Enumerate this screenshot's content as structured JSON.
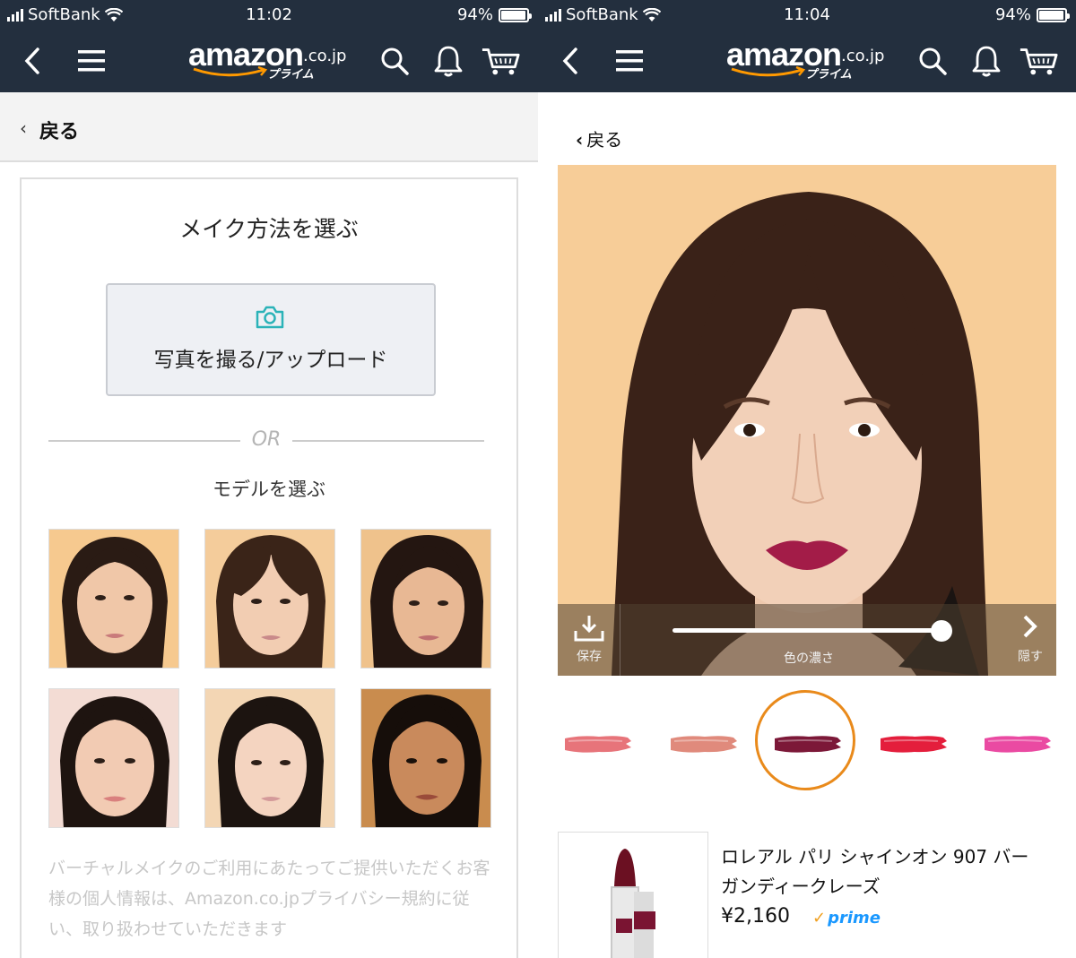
{
  "left": {
    "status": {
      "carrier": "SoftBank",
      "time": "11:02",
      "battery": "94%",
      "battery_level": 0.94
    },
    "logo": {
      "word": "amazon",
      "domain": ".co.jp",
      "sub": "プライム"
    },
    "back_label": "戻る",
    "heading": "メイク方法を選ぶ",
    "upload_label": "写真を撮る/アップロード",
    "or_text": "OR",
    "model_heading": "モデルを選ぶ",
    "disclaimer": "バーチャルメイクのご利用にあたってご提供いただくお客様の個人情報は、Amazon.co.jpプライバシー規約に従い、取り扱わせていただきます"
  },
  "right": {
    "status": {
      "carrier": "SoftBank",
      "time": "11:04",
      "battery": "94%",
      "battery_level": 0.94
    },
    "logo": {
      "word": "amazon",
      "domain": ".co.jp",
      "sub": "プライム"
    },
    "back_label": "戻る",
    "save_label": "保存",
    "slider_label": "色の濃さ",
    "slider_value": 0.96,
    "hide_label": "隠す",
    "swatches": [
      {
        "color": "#e7747a",
        "selected": false
      },
      {
        "color": "#e08a7c",
        "selected": false
      },
      {
        "color": "#7c1838",
        "selected": true
      },
      {
        "color": "#e41e3c",
        "selected": false
      },
      {
        "color": "#ea4aa2",
        "selected": false
      }
    ],
    "product": {
      "name": "ロレアル パリ シャインオン 907 バーガンディークレーズ",
      "price": "¥2,160",
      "prime": "prime"
    }
  },
  "colors": {
    "header_bg": "#232f3e",
    "accent_orange": "#e98a1b",
    "camera_teal": "#2bb3b8",
    "prime_blue": "#1a98ff"
  }
}
